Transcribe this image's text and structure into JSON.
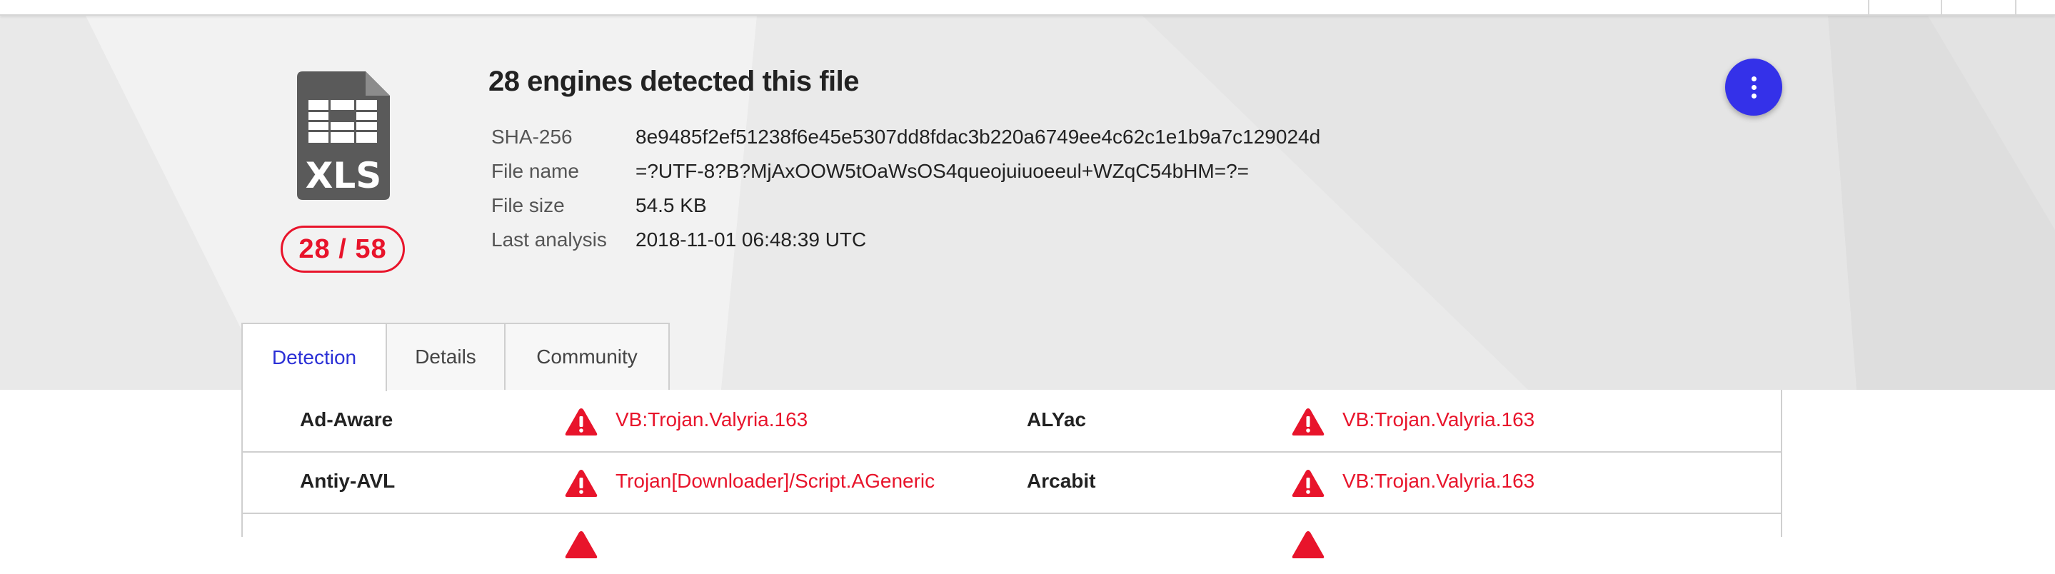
{
  "header": {
    "title": "28 engines detected this file",
    "file_type": "XLS",
    "score": "28 / 58",
    "more_icon": "more-vertical-icon",
    "accent_color": "#3431e9",
    "danger_color": "#e8142b"
  },
  "meta": [
    {
      "label": "SHA-256",
      "value": "8e9485f2ef51238f6e45e5307dd8fdac3b220a6749ee4c62c1e1b9a7c129024d"
    },
    {
      "label": "File name",
      "value": "=?UTF-8?B?MjAxOOW5tOaWsOS4queojuiuoeeul+WZqC54bHM=?="
    },
    {
      "label": "File size",
      "value": "54.5 KB"
    },
    {
      "label": "Last analysis",
      "value": "2018-11-01 06:48:39 UTC"
    }
  ],
  "tabs": [
    {
      "label": "Detection",
      "active": true
    },
    {
      "label": "Details",
      "active": false
    },
    {
      "label": "Community",
      "active": false
    }
  ],
  "detections": [
    {
      "left_engine": "Ad-Aware",
      "left_result": "VB:Trojan.Valyria.163",
      "right_engine": "ALYac",
      "right_result": "VB:Trojan.Valyria.163"
    },
    {
      "left_engine": "Antiy-AVL",
      "left_result": "Trojan[Downloader]/Script.AGeneric",
      "right_engine": "Arcabit",
      "right_result": "VB:Trojan.Valyria.163"
    }
  ]
}
